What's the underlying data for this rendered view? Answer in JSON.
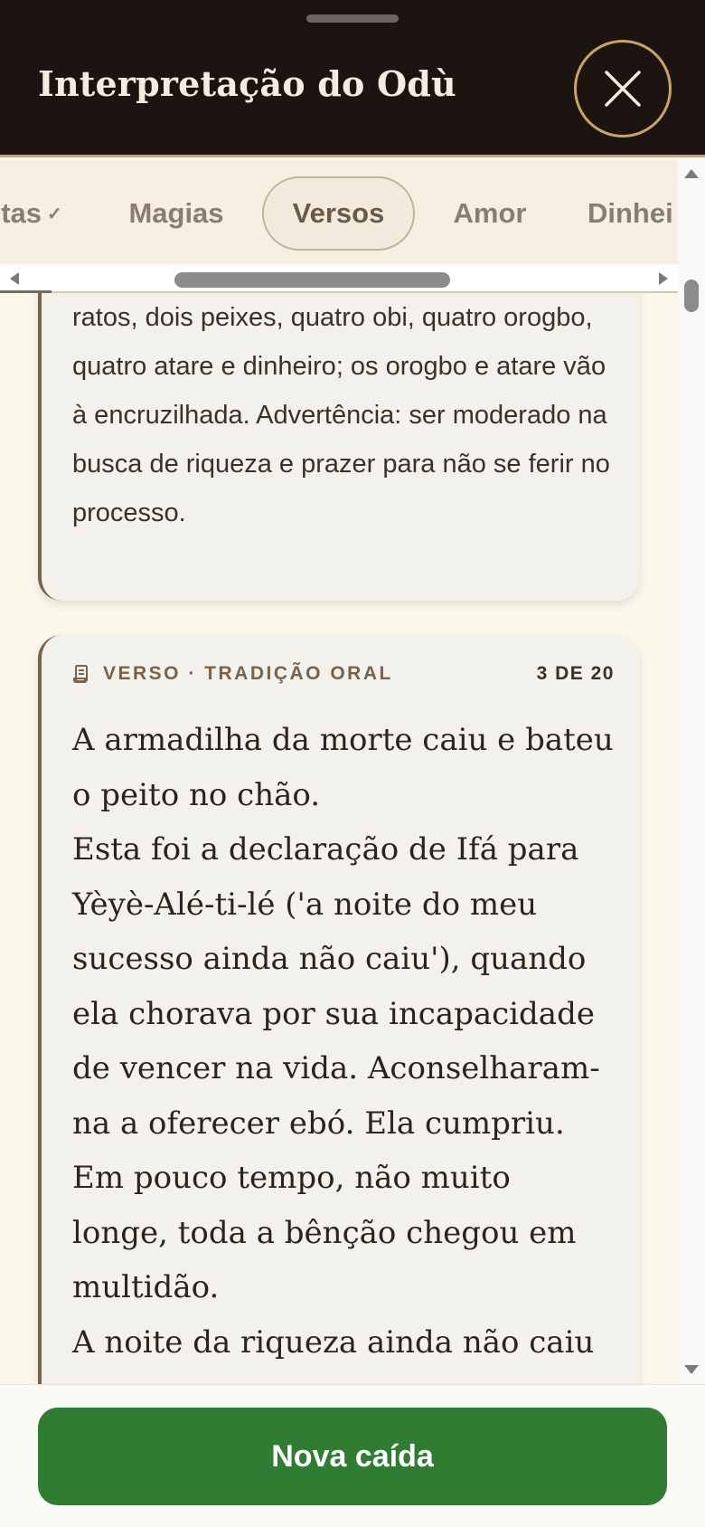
{
  "header": {
    "title": "Interpretação do Odù",
    "close_icon": "close-icon"
  },
  "tabs": [
    {
      "label": "tas",
      "check": "✓",
      "active": false
    },
    {
      "label": "Magias",
      "active": false
    },
    {
      "label": "Versos",
      "active": true
    },
    {
      "label": "Amor",
      "active": false
    },
    {
      "label": "Dinhei",
      "active": false
    }
  ],
  "previous_card": {
    "text": "ratos, dois peixes, quatro obi, quatro orogbo, quatro atare e dinheiro; os orogbo e atare vão à encruzilhada. Advertência: ser moderado na busca de riqueza e prazer para não se ferir no processo."
  },
  "verse_card": {
    "label": "VERSO · TRADIÇÃO ORAL",
    "count": "3 DE 20",
    "icon": "scroll-icon",
    "text": "A armadilha da morte caiu e bateu o peito no chão.\nEsta foi a declaração de Ifá para Yèyè-Alé-ti-lé ('a noite do meu sucesso ainda não caiu'), quando ela chorava por sua incapacidade de vencer na vida. Aconselharam-na a oferecer ebó. Ela cumpriu.\nEm pouco tempo, não muito longe, toda a bênção chegou em multidão.\nA noite da riqueza ainda não caiu"
  },
  "footer": {
    "button_label": "Nova caída"
  },
  "colors": {
    "header_bg": "#1c1410",
    "accent_gold": "#c9a463",
    "primary_green": "#2e7d32"
  }
}
